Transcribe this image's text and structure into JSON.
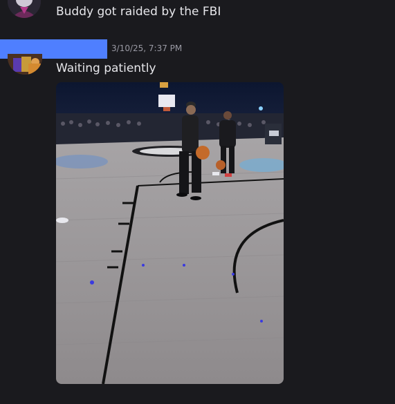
{
  "messages": [
    {
      "text": "Buddy got raided by the FBI",
      "avatar": "user-avatar"
    },
    {
      "timestamp": "3/10/25, 7:37 PM",
      "text": "Waiting patiently",
      "avatar": "user-avatar",
      "attachment": {
        "type": "image",
        "subject": "basketball-court-photo"
      }
    }
  ],
  "colors": {
    "background": "#1a1a1e",
    "redaction": "#4f7fff",
    "message_text": "#e6e6ea",
    "timestamp": "#9a9aa4"
  }
}
